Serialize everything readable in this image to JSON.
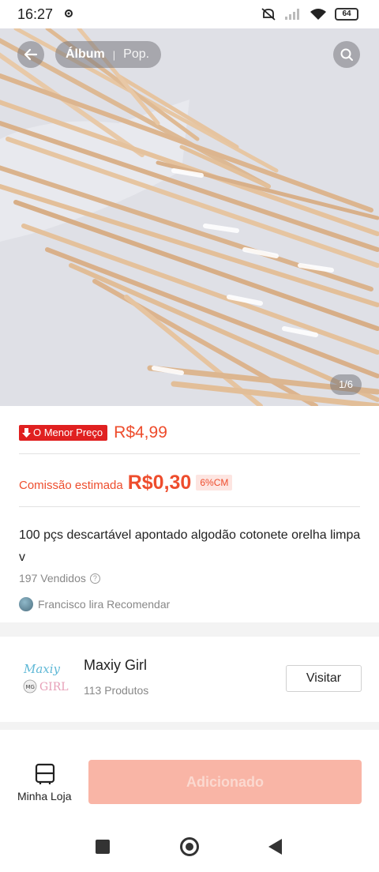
{
  "status_bar": {
    "time": "16:27",
    "battery": "64",
    "icons": [
      "notification-gear-icon",
      "mute-icon",
      "signal-icon",
      "wifi-icon",
      "battery-icon"
    ]
  },
  "gallery": {
    "tabs": [
      {
        "label": "Álbum",
        "active": true
      },
      {
        "label": "Pop.",
        "active": false
      }
    ],
    "page_indicator": "1/6",
    "image_subject": "wooden-cotton-swab-sticks"
  },
  "price": {
    "badge": "O Menor Preço",
    "value": "R$4,99"
  },
  "commission": {
    "label": "Comissão estimada",
    "value": "R$0,30",
    "rate": "6%CM"
  },
  "product": {
    "title": "100 pçs descartável apontado algodão cotonete orelha limpa v",
    "sold": "197 Vendidos",
    "recommender": "Francisco lira Recomendar"
  },
  "shop": {
    "logo_text_top": "Maxiy",
    "logo_text_badge": "MG",
    "logo_text_bottom": "GIRL",
    "name": "Maxiy Girl",
    "products": "113 Produtos",
    "visit_label": "Visitar"
  },
  "bottom_bar": {
    "store_label": "Minha Loja",
    "add_label": "Adicionado"
  },
  "colors": {
    "accent": "#ee4d2d",
    "badge_red": "#e02020",
    "disabled_button": "#f9b5a6"
  }
}
